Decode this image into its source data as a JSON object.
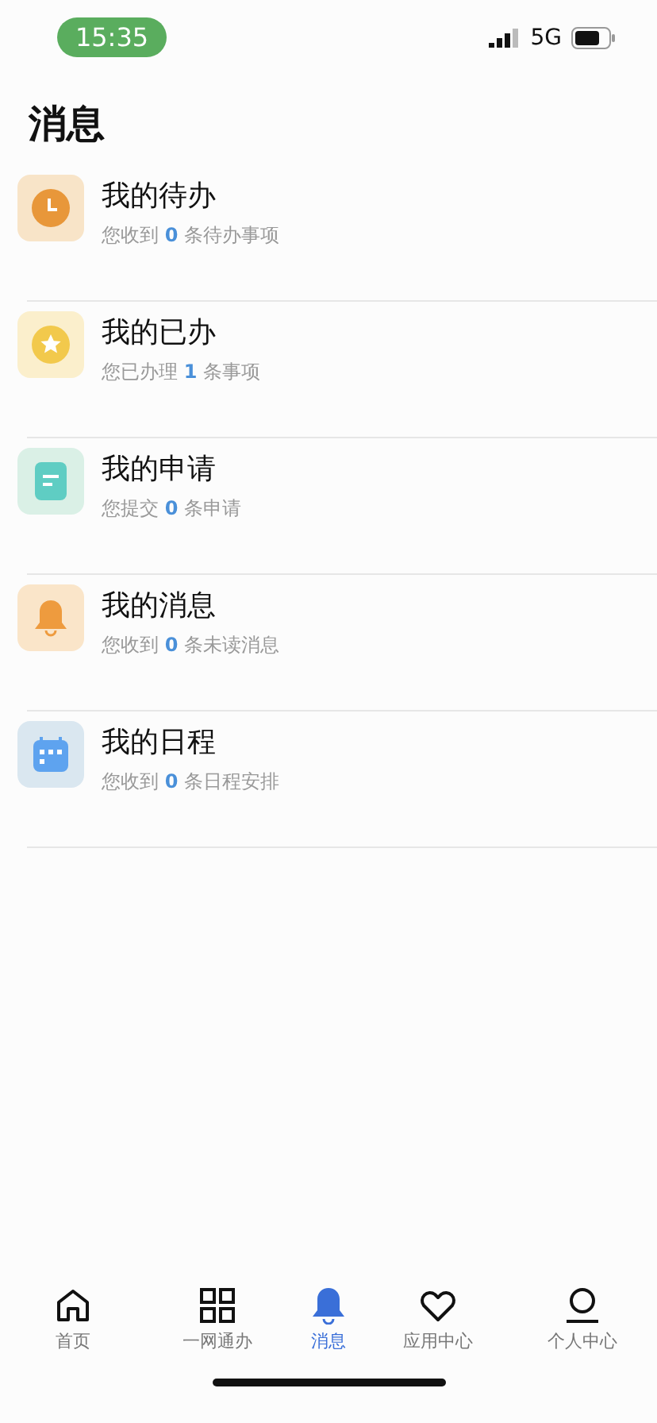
{
  "status_bar": {
    "time": "15:35",
    "network": "5G"
  },
  "header": {
    "title": "消息"
  },
  "items": [
    {
      "kind": "clock",
      "color": "#e8973a",
      "title": "我的待办",
      "prefix": "您收到",
      "count": "0",
      "suffix": "条待办事项"
    },
    {
      "kind": "star",
      "color": "#f2c94c",
      "title": "我的已办",
      "prefix": "您已办理",
      "count": "1",
      "suffix": "条事项"
    },
    {
      "kind": "doc",
      "color": "#5fcdc3",
      "title": "我的申请",
      "prefix": "您提交",
      "count": "0",
      "suffix": "条申请"
    },
    {
      "kind": "bell",
      "color": "#ee9b3e",
      "title": "我的消息",
      "prefix": "您收到",
      "count": "0",
      "suffix": "条未读消息"
    },
    {
      "kind": "calendar",
      "color": "#5ea3ef",
      "title": "我的日程",
      "prefix": "您收到",
      "count": "0",
      "suffix": "条日程安排"
    }
  ],
  "tab_bar": [
    {
      "kind": "home",
      "label": "首页",
      "selected": false
    },
    {
      "kind": "grid",
      "label": "一网通办",
      "selected": false
    },
    {
      "kind": "bell",
      "label": "消息",
      "selected": true
    },
    {
      "kind": "heart",
      "label": "应用中心",
      "selected": false
    },
    {
      "kind": "person",
      "label": "个人中心",
      "selected": false
    }
  ]
}
